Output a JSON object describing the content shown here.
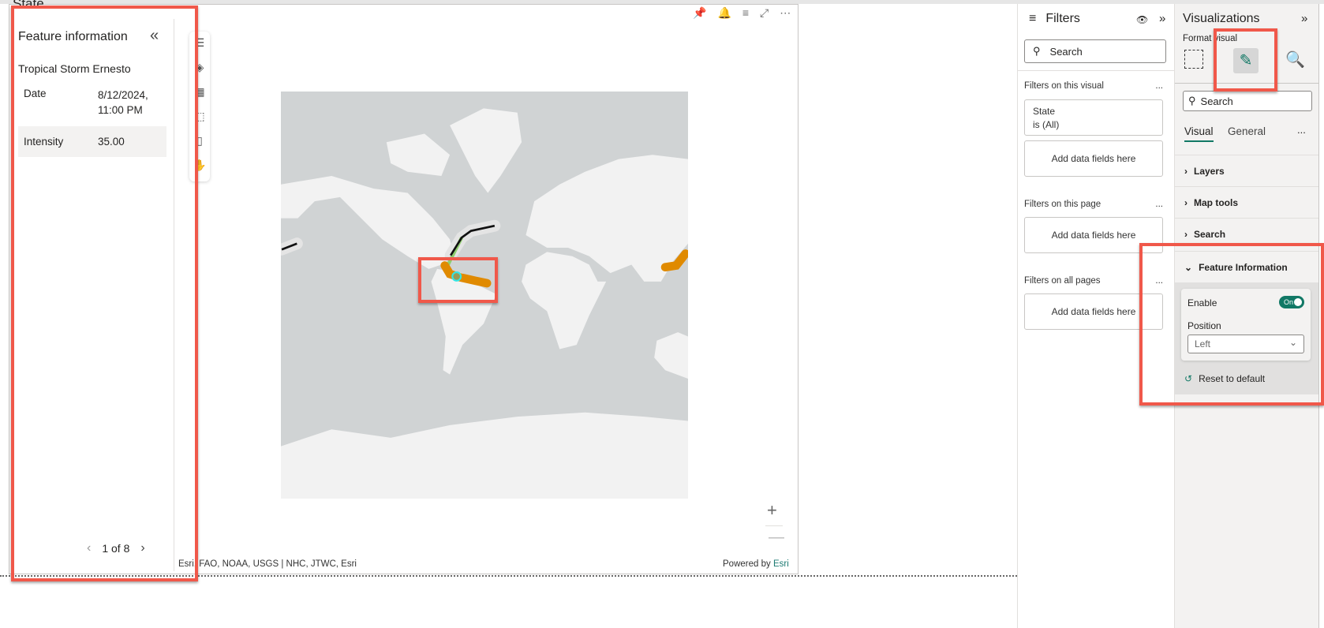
{
  "visual": {
    "slicer_title": "State",
    "header_icons": [
      "pin-icon",
      "bell-icon",
      "filter-icon",
      "focus-mode-icon",
      "more-options-icon"
    ]
  },
  "feature_info": {
    "title": "Feature information",
    "name": "Tropical Storm Ernesto",
    "rows": [
      {
        "key": "Date",
        "value": "8/12/2024, 11:00 PM"
      },
      {
        "key": "Intensity",
        "value": "35.00"
      }
    ],
    "pager": "1 of 8"
  },
  "map": {
    "attribution": "Esri, FAO, NOAA, USGS | NHC, JTWC, Esri",
    "powered_by": "Powered by",
    "esri": "Esri",
    "zoom_in": "+",
    "zoom_out": "—"
  },
  "filters": {
    "title": "Filters",
    "search_placeholder": "Search",
    "on_visual": "Filters on this visual",
    "state_filter": "State",
    "state_value": "is (All)",
    "add_fields": "Add data fields here",
    "on_page": "Filters on this page",
    "on_all": "Filters on all pages",
    "more": "..."
  },
  "viz": {
    "title": "Visualizations",
    "format_visual": "Format visual",
    "search_placeholder": "Search",
    "tabs": [
      "Visual",
      "General"
    ],
    "more": "...",
    "sections": [
      "Layers",
      "Map tools",
      "Search",
      "Feature Information"
    ],
    "enable_label": "Enable",
    "toggle": "On",
    "position_label": "Position",
    "position_value": "Left",
    "reset": "Reset to default"
  },
  "colors": {
    "accent": "#117865",
    "highlight": "#f0584a",
    "storm": "#e08a00"
  }
}
